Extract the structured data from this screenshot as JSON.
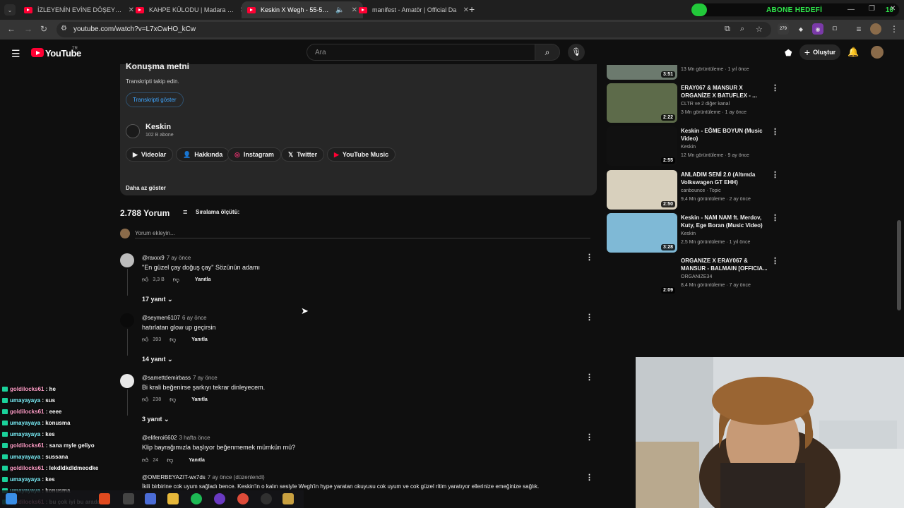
{
  "browser": {
    "tabs": [
      {
        "title": "İZLEYENİN EVİNE DÖŞEYEN KOŞ",
        "active": false
      },
      {
        "title": "KAHPE KÜLODU | Madara Oldu",
        "active": false
      },
      {
        "title": "Keskin X Wegh - 55-53 (Mu",
        "active": true
      },
      {
        "title": "manifest - Amatör | Official Da",
        "active": false
      }
    ],
    "url": "youtube.com/watch?v=L7xCwHO_kCw",
    "ext_badge": "279",
    "subscribe_goal": {
      "label": "ABONE HEDEFİ",
      "count": "10",
      "progress": 0.04,
      "color": "#22c93a"
    }
  },
  "header": {
    "brand": "YouTube",
    "region": "TR",
    "search_placeholder": "Ara",
    "create_label": "Oluştur"
  },
  "description": {
    "transcript_title": "Konuşma metni",
    "transcript_sub": "Transkripti takip edin.",
    "transcript_button": "Transkripti göster",
    "channel_name": "Keskin",
    "channel_subs": "102 B abone",
    "chips": [
      "Videolar",
      "Hakkında",
      "Instagram",
      "Twitter",
      "YouTube Music"
    ],
    "show_less": "Daha az göster"
  },
  "comments": {
    "count": "2.788 Yorum",
    "sort_label": "Sıralama ölçütü:",
    "add_placeholder": "Yorum ekleyin...",
    "reply_label": "Yanıtla",
    "items": [
      {
        "user": "@raxxx9",
        "time": "7 ay önce",
        "text": "\"En güzel çay doğuş çay\" Sözünün adamı",
        "likes": "3,3 B",
        "replies": "17 yanıt"
      },
      {
        "user": "@seymen6107",
        "time": "6 ay önce",
        "text": "hatırlatan glow up geçirsin",
        "likes": "393",
        "replies": "14 yanıt"
      },
      {
        "user": "@samettdemirbass",
        "time": "7 ay önce",
        "text": "Bi krali beğenirse şarkıyı tekrar dinleyecem.",
        "likes": "238",
        "replies": "3 yanıt"
      },
      {
        "user": "@eliferoi6602",
        "time": "3 hafta önce",
        "text": "Klip bayrağımızla başlıyor beğenmemek mümkün mü?",
        "likes": "24",
        "replies": ""
      },
      {
        "user": "@OMERBEYAZIT-wx7ds",
        "time": "7 ay önce (düzenlendi)",
        "text": "İkili birbirine cok uyum sağladı bence. Keskin'in o kalın sesiyle Wegh'in hype yaratan okuyusu cok uyum ve cok güzel ritim yaratıyor ellerinize emeğinize sağlık.",
        "likes": "",
        "replies": ""
      }
    ]
  },
  "related": [
    {
      "title": "",
      "channel": "",
      "meta": "13 Mn görüntüleme · 1 yıl önce",
      "duration": "3:51",
      "thumb_color": "#6c7a6e"
    },
    {
      "title": "ERAY067 & MANSUR X ORGANİZE X BATUFLEX - ...",
      "channel": "CLTR ve 2 diğer kanal",
      "meta": "3 Mn görüntüleme · 1 ay önce",
      "duration": "2:22",
      "thumb_color": "#5d6b4a"
    },
    {
      "title": "Keskin - EĞME BOYUN (Music Video)",
      "channel": "Keskin",
      "meta": "12 Mn görüntüleme · 9 ay önce",
      "duration": "2:55",
      "thumb_color": "#111111"
    },
    {
      "title": "ANLADIM SENİ 2.0 (Altımda Volkswagen GT EHH)",
      "channel": "canbounce · Topic",
      "meta": "9,4 Mn görüntüleme · 2 ay önce",
      "duration": "2:50",
      "thumb_color": "#d8d0bd"
    },
    {
      "title": "Keskin - NAM NAM ft. Merdov, Kuty, Ege Boran (Music Video)",
      "channel": "Keskin",
      "meta": "2,5 Mn görüntüleme · 1 yıl önce",
      "duration": "3:28",
      "thumb_color": "#7fb9d6"
    },
    {
      "title": "ORGANIZE X ERAY067 & MANSUR - BALMAIN [OFFICIA...",
      "channel": "ORGANIZE34",
      "meta": "8,4 Mn görüntüleme · 7 ay önce",
      "duration": "2:09",
      "thumb_color": "#0f0f0f"
    }
  ],
  "chat": [
    {
      "user": "goldilocks61",
      "msg": ": he"
    },
    {
      "user": "umayayaya",
      "msg": ": sus"
    },
    {
      "user": "goldilocks61",
      "msg": ": eeee"
    },
    {
      "user": "umayayaya",
      "msg": ": konusma"
    },
    {
      "user": "umayayaya",
      "msg": ": kes"
    },
    {
      "user": "goldilocks61",
      "msg": ": sana myle geliyo"
    },
    {
      "user": "umayayaya",
      "msg": ": sussana"
    },
    {
      "user": "goldilocks61",
      "msg": ": lekdldkdldmeodke"
    },
    {
      "user": "umayayaya",
      "msg": ": kes"
    },
    {
      "user": "umayayaya",
      "msg": ": konusma"
    },
    {
      "user": "goldilocks61",
      "msg": ": bu çok iyi bu arada"
    }
  ]
}
